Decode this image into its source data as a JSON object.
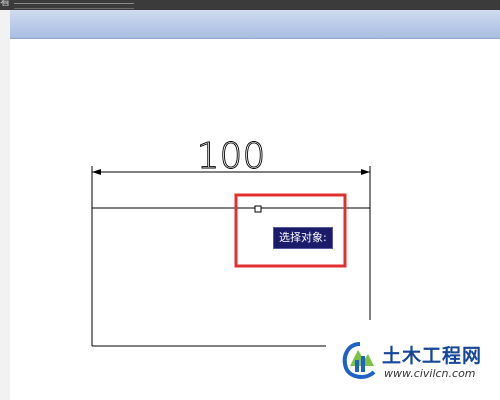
{
  "window": {
    "menu_label": "看"
  },
  "drawing": {
    "dimension_text": "100",
    "prompt_text": "选择对象:"
  },
  "colors": {
    "highlight_box": "#e03030",
    "prompt_bg": "#1b1b6b",
    "viewport_header": "#b9c9e6"
  },
  "watermark": {
    "title": "土木工程网",
    "url": "www.civilcn.com",
    "logo_icon": "civilcn-logo-icon"
  }
}
